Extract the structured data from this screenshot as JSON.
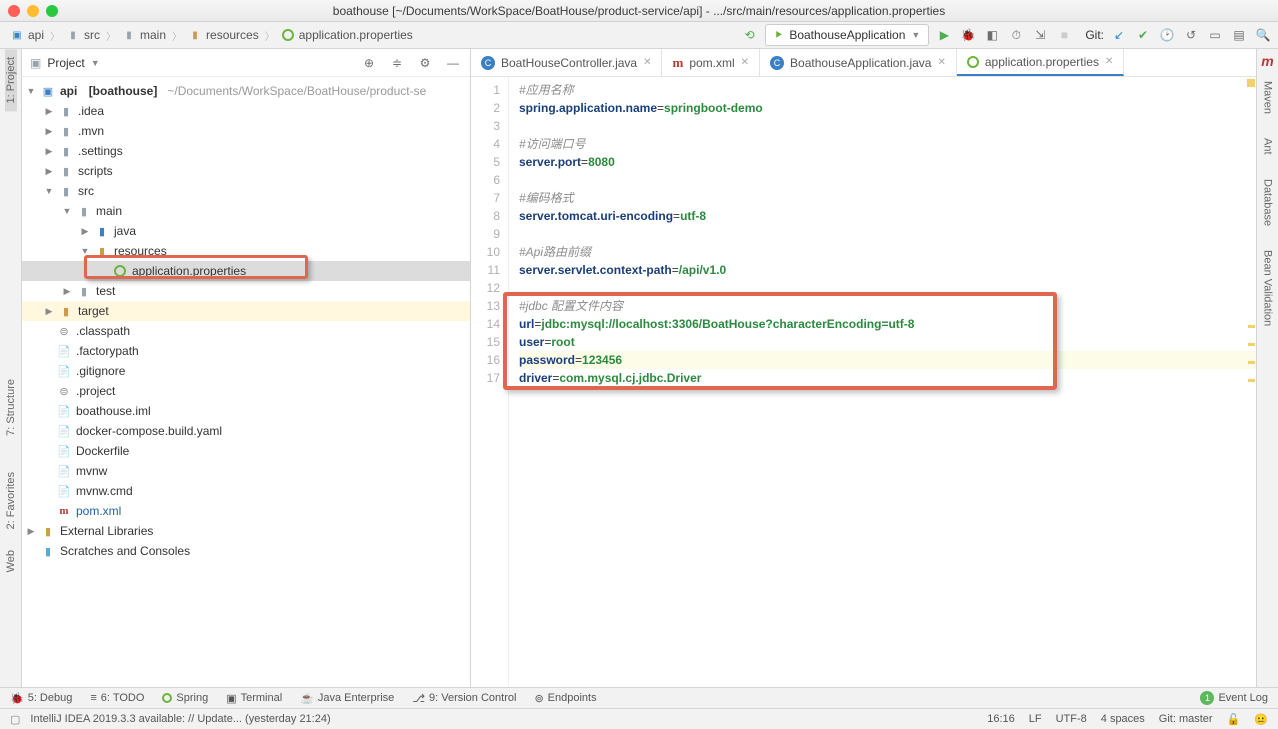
{
  "window_title": "boathouse [~/Documents/WorkSpace/BoatHouse/product-service/api] - .../src/main/resources/application.properties",
  "breadcrumbs": [
    "api",
    "src",
    "main",
    "resources",
    "application.properties"
  ],
  "run_config": "BoathouseApplication",
  "git_label": "Git:",
  "project_panel": {
    "title": "Project"
  },
  "tree": {
    "root": {
      "name": "api",
      "label": "[boathouse]",
      "path": "~/Documents/WorkSpace/BoatHouse/product-se"
    },
    "idea": ".idea",
    "mvn": ".mvn",
    "settings": ".settings",
    "scripts": "scripts",
    "src": "src",
    "main": "main",
    "java": "java",
    "resources": "resources",
    "appprops": "application.properties",
    "test": "test",
    "target": "target",
    "classpath": ".classpath",
    "factorypath": ".factorypath",
    "gitignore": ".gitignore",
    "project": ".project",
    "iml": "boathouse.iml",
    "dockercompose": "docker-compose.build.yaml",
    "dockerfile": "Dockerfile",
    "mvnw": "mvnw",
    "mvnwcmd": "mvnw.cmd",
    "pom": "pom.xml",
    "extlibs": "External Libraries",
    "scratches": "Scratches and Consoles"
  },
  "tabs": [
    {
      "label": "BoatHouseController.java",
      "icon": "c"
    },
    {
      "label": "pom.xml",
      "icon": "m"
    },
    {
      "label": "BoathouseApplication.java",
      "icon": "c"
    },
    {
      "label": "application.properties",
      "icon": "spring",
      "active": true
    }
  ],
  "code_lines": [
    {
      "n": 1,
      "type": "c",
      "text": "#应用名称"
    },
    {
      "n": 2,
      "type": "kv",
      "k": "spring.application.name",
      "v": "springboot-demo"
    },
    {
      "n": 3,
      "type": "blank"
    },
    {
      "n": 4,
      "type": "c",
      "text": "#访问端口号"
    },
    {
      "n": 5,
      "type": "kv",
      "k": "server.port",
      "v": "8080"
    },
    {
      "n": 6,
      "type": "blank"
    },
    {
      "n": 7,
      "type": "c",
      "text": "#编码格式"
    },
    {
      "n": 8,
      "type": "kv",
      "k": "server.tomcat.uri-encoding",
      "v": "utf-8"
    },
    {
      "n": 9,
      "type": "blank"
    },
    {
      "n": 10,
      "type": "c",
      "text": "#Api路由前缀"
    },
    {
      "n": 11,
      "type": "kv",
      "k": "server.servlet.context-path",
      "v": "/api/v1.0"
    },
    {
      "n": 12,
      "type": "blank"
    },
    {
      "n": 13,
      "type": "c",
      "text": "#jdbc 配置文件内容"
    },
    {
      "n": 14,
      "type": "kv",
      "k": "url",
      "v": "jdbc:mysql://localhost:3306/BoatHouse?characterEncoding=utf-8"
    },
    {
      "n": 15,
      "type": "kv",
      "k": "user",
      "v": "root"
    },
    {
      "n": 16,
      "type": "kv",
      "k": "password",
      "v": "123456",
      "caret": true
    },
    {
      "n": 17,
      "type": "kv",
      "k": "driver",
      "v": "com.mysql.cj.jdbc.Driver"
    }
  ],
  "bottom_tools": [
    "5: Debug",
    "6: TODO",
    "Spring",
    "Terminal",
    "Java Enterprise",
    "9: Version Control",
    "Endpoints"
  ],
  "event_log": "Event Log",
  "status_message": "IntelliJ IDEA 2019.3.3 available: // Update... (yesterday 21:24)",
  "status_right": {
    "pos": "16:16",
    "eol": "LF",
    "enc": "UTF-8",
    "indent": "4 spaces",
    "branch": "Git: master"
  },
  "rails": {
    "left": [
      "1: Project",
      "7: Structure",
      "2: Favorites",
      "Web"
    ],
    "right": [
      "Maven",
      "Ant",
      "Database",
      "Bean Validation"
    ],
    "right_logo": "m"
  }
}
